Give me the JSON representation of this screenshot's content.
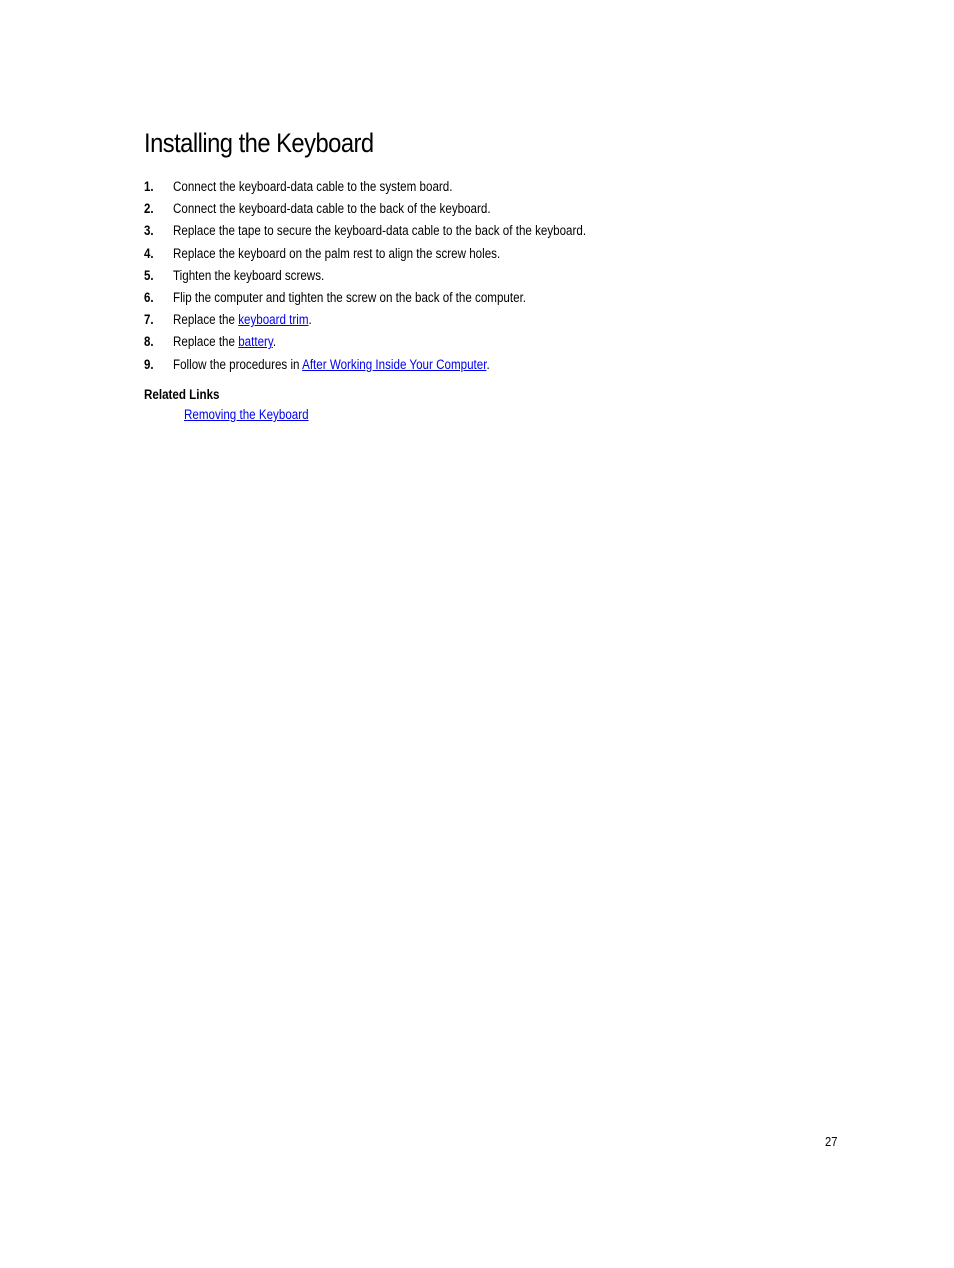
{
  "title": "Installing the Keyboard",
  "steps": [
    {
      "num": "1.",
      "parts": [
        {
          "text": "Connect the keyboard-data cable to the system board."
        }
      ]
    },
    {
      "num": "2.",
      "parts": [
        {
          "text": "Connect the keyboard-data cable to the back of the keyboard."
        }
      ]
    },
    {
      "num": "3.",
      "parts": [
        {
          "text": "Replace the tape to secure the keyboard-data cable to the back of the keyboard."
        }
      ]
    },
    {
      "num": "4.",
      "parts": [
        {
          "text": "Replace the keyboard on the palm rest to align the screw holes."
        }
      ]
    },
    {
      "num": "5.",
      "parts": [
        {
          "text": "Tighten the keyboard screws."
        }
      ]
    },
    {
      "num": "6.",
      "parts": [
        {
          "text": "Flip the computer and tighten the screw on the back of the computer."
        }
      ]
    },
    {
      "num": "7.",
      "parts": [
        {
          "text": "Replace the "
        },
        {
          "text": "keyboard trim",
          "link": true
        },
        {
          "text": "."
        }
      ]
    },
    {
      "num": "8.",
      "parts": [
        {
          "text": "Replace the "
        },
        {
          "text": "battery",
          "link": true
        },
        {
          "text": "."
        }
      ]
    },
    {
      "num": "9.",
      "parts": [
        {
          "text": "Follow the procedures in "
        },
        {
          "text": "After Working Inside Your Computer",
          "link": true
        },
        {
          "text": "."
        }
      ]
    }
  ],
  "related": {
    "heading": "Related Links",
    "links": [
      "Removing the Keyboard"
    ]
  },
  "page_number": "27",
  "colors": {
    "link": "#0000ee",
    "text": "#000000"
  }
}
